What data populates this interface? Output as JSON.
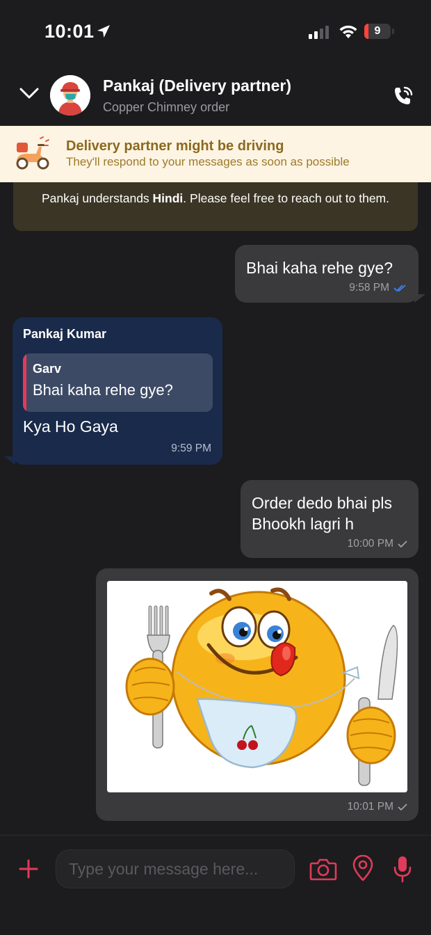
{
  "status_bar": {
    "time": "10:01",
    "battery_level": "9"
  },
  "header": {
    "contact_name": "Pankaj (Delivery partner)",
    "subtitle": "Copper Chimney order"
  },
  "banner": {
    "title": "Delivery partner might be driving",
    "subtitle": "They'll respond to your messages as soon as possible"
  },
  "language_note": {
    "prefix": "Pankaj understands ",
    "language": "Hindi",
    "suffix": ". Please feel free to reach out to them."
  },
  "messages": [
    {
      "direction": "outgoing",
      "text": "Bhai kaha rehe gye?",
      "time": "9:58 PM",
      "status": "read"
    },
    {
      "direction": "incoming",
      "sender": "Pankaj Kumar",
      "quote": {
        "name": "Garv",
        "text": "Bhai kaha rehe gye?"
      },
      "text": "Kya Ho Gaya",
      "time": "9:59 PM"
    },
    {
      "direction": "outgoing",
      "line1": "Order dedo bhai pls",
      "line2": "Bhookh lagri h",
      "time": "10:00 PM",
      "status": "sent"
    },
    {
      "direction": "outgoing",
      "type": "image",
      "image_subject": "hungry smiley emoji with fork, knife and bib",
      "time": "10:01 PM",
      "status": "sent"
    }
  ],
  "composer": {
    "placeholder": "Type your message here..."
  },
  "colors": {
    "background": "#1c1c1e",
    "outgoing_bubble": "#3a3a3c",
    "incoming_bubble": "#1a2a4a",
    "accent": "#e23a5a",
    "read_tick": "#3b82f6",
    "banner_bg": "#fdf4e3"
  },
  "icons": [
    "location-arrow-icon",
    "signal-icon",
    "wifi-icon",
    "battery-icon",
    "chevron-down-icon",
    "avatar",
    "phone-call-icon",
    "scooter-icon",
    "double-check-icon",
    "check-icon",
    "plus-icon",
    "camera-icon",
    "location-pin-icon",
    "microphone-icon"
  ]
}
